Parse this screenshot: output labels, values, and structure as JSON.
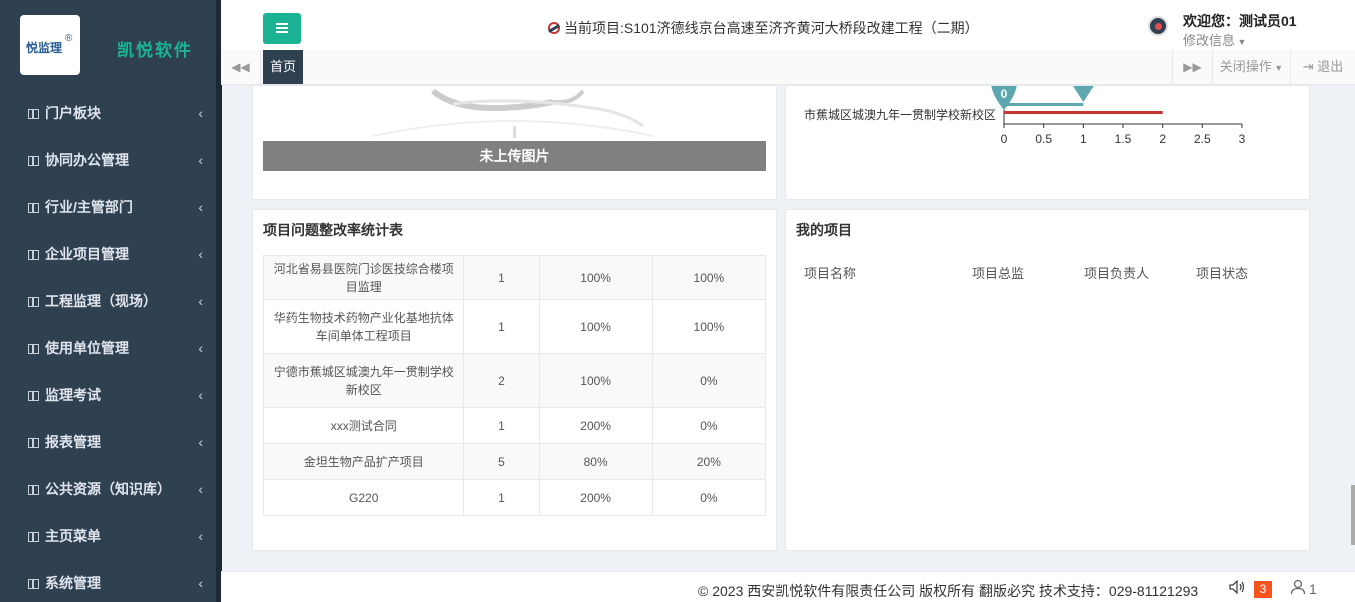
{
  "sidebar": {
    "logo_text": "悦监理",
    "logo_reg": "®",
    "brand": "凯悦软件",
    "items": [
      {
        "label": "门户板块"
      },
      {
        "label": "协同办公管理"
      },
      {
        "label": "行业/主管部门"
      },
      {
        "label": "企业项目管理"
      },
      {
        "label": "工程监理（现场）"
      },
      {
        "label": "使用单位管理"
      },
      {
        "label": "监理考试"
      },
      {
        "label": "报表管理"
      },
      {
        "label": "公共资源（知识库）"
      },
      {
        "label": "主页菜单"
      },
      {
        "label": "系统管理"
      }
    ]
  },
  "header": {
    "project": "当前项目:S101济德线京台高速至济齐黄河大桥段改建工程（二期）",
    "welcome": "欢迎您：测试员01",
    "modify": "修改信息"
  },
  "tabs": {
    "home": "首页",
    "close_ops": "关闭操作",
    "exit": "退出"
  },
  "image_panel": {
    "no_image": "未上传图片"
  },
  "chart_data": {
    "type": "bar",
    "orientation": "horizontal",
    "categories": [
      "市蕉城区城澳九年一贯制学校新校区"
    ],
    "series": [
      {
        "values": [
          1
        ],
        "color": "#5ca7b0"
      },
      {
        "values": [
          2
        ],
        "color": "#c23531"
      }
    ],
    "markers": [
      {
        "value": 0,
        "label": "0"
      },
      {
        "value": 1,
        "label": ""
      }
    ],
    "xticks": [
      "0",
      "0.5",
      "1",
      "1.5",
      "2",
      "2.5",
      "3"
    ],
    "xlim": [
      0,
      3
    ]
  },
  "issue_table": {
    "title": "项目问题整改率统计表",
    "rows": [
      {
        "name": "河北省易县医院门诊医技综合楼项目监理",
        "count": "1",
        "a": "100%",
        "b": "100%"
      },
      {
        "name": "华药生物技术药物产业化基地抗体车间单体工程项目",
        "count": "1",
        "a": "100%",
        "b": "100%"
      },
      {
        "name": "宁德市蕉城区城澳九年一贯制学校新校区",
        "count": "2",
        "a": "100%",
        "b": "0%"
      },
      {
        "name": "xxx测试合同",
        "count": "1",
        "a": "200%",
        "b": "0%"
      },
      {
        "name": "金坦生物产品扩产项目",
        "count": "5",
        "a": "80%",
        "b": "20%"
      },
      {
        "name": "G220",
        "count": "1",
        "a": "200%",
        "b": "0%"
      }
    ]
  },
  "my_projects": {
    "title": "我的项目",
    "headers": [
      "项目名称",
      "项目总监",
      "项目负责人",
      "项目状态"
    ]
  },
  "footer": {
    "copyright": "© 2023 西安凯悦软件有限责任公司 版权所有 翻版必究 技术支持：029-81121293",
    "badge": "3",
    "user_count": "1"
  }
}
